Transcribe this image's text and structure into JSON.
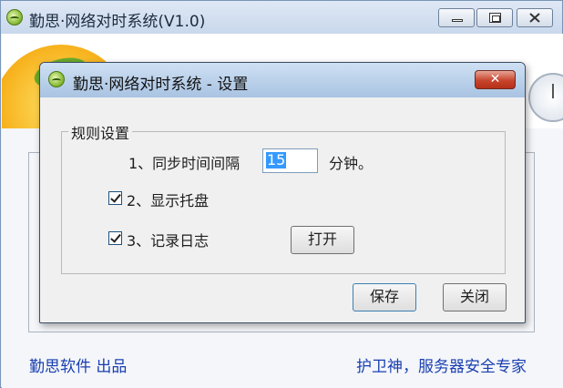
{
  "main_window": {
    "title": "勤思·网络对时系统(V1.0)",
    "footer_left": "勤思软件 出品",
    "footer_right": "护卫神，服务器安全专家"
  },
  "dialog": {
    "title": "勤思·网络对时系统 - 设置",
    "close_glyph": "✕",
    "group_label": "规则设置",
    "sync_interval": {
      "prefix": "1、同步时间间隔",
      "value": "15",
      "suffix": "分钟。"
    },
    "show_tray": {
      "label": "2、显示托盘",
      "checked": true
    },
    "log": {
      "label": "3、记录日志",
      "checked": true,
      "open_button": "打开"
    },
    "buttons": {
      "save": "保存",
      "close": "关闭"
    }
  },
  "colors": {
    "footer_link": "#1a3fb0",
    "close_button": "#c7442d",
    "selection": "#3399ff"
  }
}
